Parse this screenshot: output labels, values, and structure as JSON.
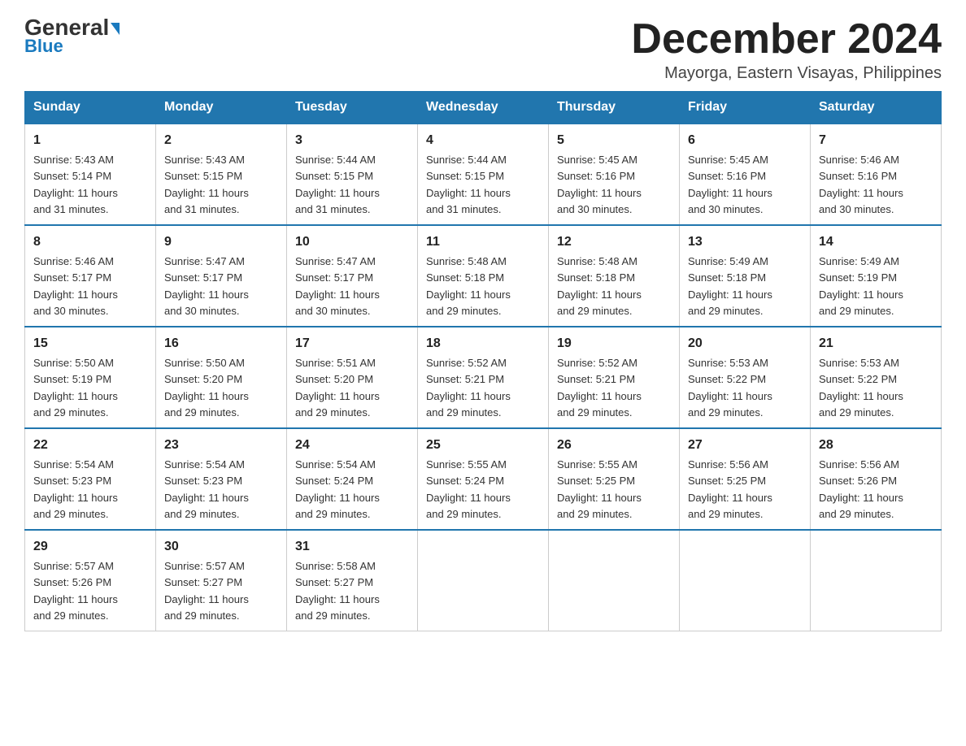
{
  "header": {
    "logo_general": "General",
    "logo_blue": "Blue",
    "month_title": "December 2024",
    "subtitle": "Mayorga, Eastern Visayas, Philippines"
  },
  "weekdays": [
    "Sunday",
    "Monday",
    "Tuesday",
    "Wednesday",
    "Thursday",
    "Friday",
    "Saturday"
  ],
  "weeks": [
    [
      {
        "day": "1",
        "info": "Sunrise: 5:43 AM\nSunset: 5:14 PM\nDaylight: 11 hours\nand 31 minutes."
      },
      {
        "day": "2",
        "info": "Sunrise: 5:43 AM\nSunset: 5:15 PM\nDaylight: 11 hours\nand 31 minutes."
      },
      {
        "day": "3",
        "info": "Sunrise: 5:44 AM\nSunset: 5:15 PM\nDaylight: 11 hours\nand 31 minutes."
      },
      {
        "day": "4",
        "info": "Sunrise: 5:44 AM\nSunset: 5:15 PM\nDaylight: 11 hours\nand 31 minutes."
      },
      {
        "day": "5",
        "info": "Sunrise: 5:45 AM\nSunset: 5:16 PM\nDaylight: 11 hours\nand 30 minutes."
      },
      {
        "day": "6",
        "info": "Sunrise: 5:45 AM\nSunset: 5:16 PM\nDaylight: 11 hours\nand 30 minutes."
      },
      {
        "day": "7",
        "info": "Sunrise: 5:46 AM\nSunset: 5:16 PM\nDaylight: 11 hours\nand 30 minutes."
      }
    ],
    [
      {
        "day": "8",
        "info": "Sunrise: 5:46 AM\nSunset: 5:17 PM\nDaylight: 11 hours\nand 30 minutes."
      },
      {
        "day": "9",
        "info": "Sunrise: 5:47 AM\nSunset: 5:17 PM\nDaylight: 11 hours\nand 30 minutes."
      },
      {
        "day": "10",
        "info": "Sunrise: 5:47 AM\nSunset: 5:17 PM\nDaylight: 11 hours\nand 30 minutes."
      },
      {
        "day": "11",
        "info": "Sunrise: 5:48 AM\nSunset: 5:18 PM\nDaylight: 11 hours\nand 29 minutes."
      },
      {
        "day": "12",
        "info": "Sunrise: 5:48 AM\nSunset: 5:18 PM\nDaylight: 11 hours\nand 29 minutes."
      },
      {
        "day": "13",
        "info": "Sunrise: 5:49 AM\nSunset: 5:18 PM\nDaylight: 11 hours\nand 29 minutes."
      },
      {
        "day": "14",
        "info": "Sunrise: 5:49 AM\nSunset: 5:19 PM\nDaylight: 11 hours\nand 29 minutes."
      }
    ],
    [
      {
        "day": "15",
        "info": "Sunrise: 5:50 AM\nSunset: 5:19 PM\nDaylight: 11 hours\nand 29 minutes."
      },
      {
        "day": "16",
        "info": "Sunrise: 5:50 AM\nSunset: 5:20 PM\nDaylight: 11 hours\nand 29 minutes."
      },
      {
        "day": "17",
        "info": "Sunrise: 5:51 AM\nSunset: 5:20 PM\nDaylight: 11 hours\nand 29 minutes."
      },
      {
        "day": "18",
        "info": "Sunrise: 5:52 AM\nSunset: 5:21 PM\nDaylight: 11 hours\nand 29 minutes."
      },
      {
        "day": "19",
        "info": "Sunrise: 5:52 AM\nSunset: 5:21 PM\nDaylight: 11 hours\nand 29 minutes."
      },
      {
        "day": "20",
        "info": "Sunrise: 5:53 AM\nSunset: 5:22 PM\nDaylight: 11 hours\nand 29 minutes."
      },
      {
        "day": "21",
        "info": "Sunrise: 5:53 AM\nSunset: 5:22 PM\nDaylight: 11 hours\nand 29 minutes."
      }
    ],
    [
      {
        "day": "22",
        "info": "Sunrise: 5:54 AM\nSunset: 5:23 PM\nDaylight: 11 hours\nand 29 minutes."
      },
      {
        "day": "23",
        "info": "Sunrise: 5:54 AM\nSunset: 5:23 PM\nDaylight: 11 hours\nand 29 minutes."
      },
      {
        "day": "24",
        "info": "Sunrise: 5:54 AM\nSunset: 5:24 PM\nDaylight: 11 hours\nand 29 minutes."
      },
      {
        "day": "25",
        "info": "Sunrise: 5:55 AM\nSunset: 5:24 PM\nDaylight: 11 hours\nand 29 minutes."
      },
      {
        "day": "26",
        "info": "Sunrise: 5:55 AM\nSunset: 5:25 PM\nDaylight: 11 hours\nand 29 minutes."
      },
      {
        "day": "27",
        "info": "Sunrise: 5:56 AM\nSunset: 5:25 PM\nDaylight: 11 hours\nand 29 minutes."
      },
      {
        "day": "28",
        "info": "Sunrise: 5:56 AM\nSunset: 5:26 PM\nDaylight: 11 hours\nand 29 minutes."
      }
    ],
    [
      {
        "day": "29",
        "info": "Sunrise: 5:57 AM\nSunset: 5:26 PM\nDaylight: 11 hours\nand 29 minutes."
      },
      {
        "day": "30",
        "info": "Sunrise: 5:57 AM\nSunset: 5:27 PM\nDaylight: 11 hours\nand 29 minutes."
      },
      {
        "day": "31",
        "info": "Sunrise: 5:58 AM\nSunset: 5:27 PM\nDaylight: 11 hours\nand 29 minutes."
      },
      {
        "day": "",
        "info": ""
      },
      {
        "day": "",
        "info": ""
      },
      {
        "day": "",
        "info": ""
      },
      {
        "day": "",
        "info": ""
      }
    ]
  ]
}
